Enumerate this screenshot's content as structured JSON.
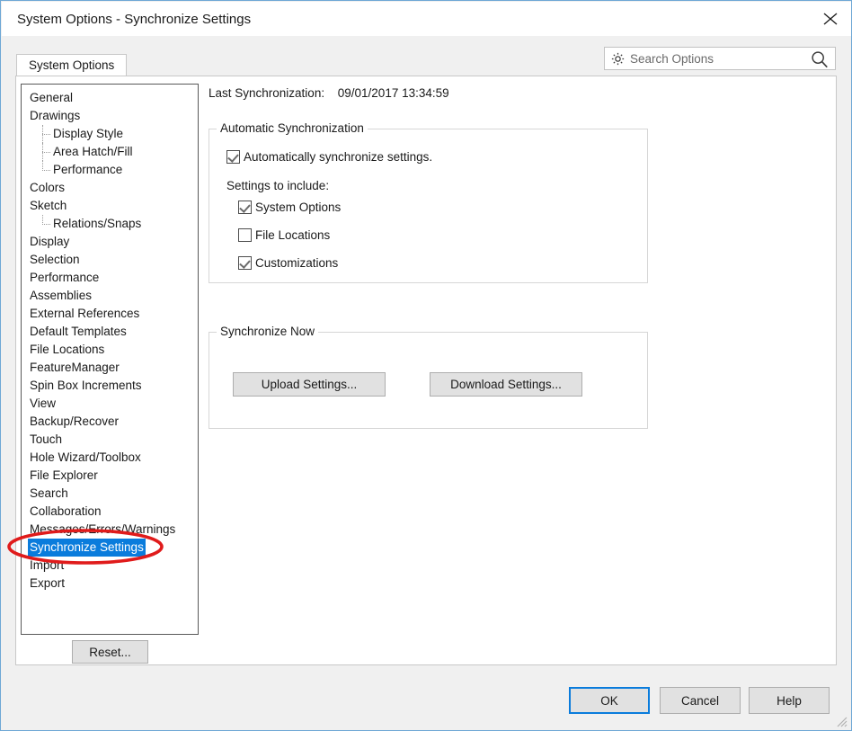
{
  "window": {
    "title": "System Options - Synchronize Settings",
    "close_icon": "close-icon",
    "resize_grip_icon": "resize-grip-icon"
  },
  "tabs": [
    {
      "label": "System Options",
      "active": true
    }
  ],
  "search": {
    "placeholder": "Search Options",
    "value": "",
    "gear_icon": "gear-icon",
    "search_icon": "magnifier-icon"
  },
  "sidebar": {
    "items": [
      {
        "label": "General",
        "level": 0,
        "selected": false
      },
      {
        "label": "Drawings",
        "level": 0,
        "selected": false
      },
      {
        "label": "Display Style",
        "level": 1,
        "selected": false
      },
      {
        "label": "Area Hatch/Fill",
        "level": 1,
        "selected": false
      },
      {
        "label": "Performance",
        "level": 1,
        "selected": false
      },
      {
        "label": "Colors",
        "level": 0,
        "selected": false
      },
      {
        "label": "Sketch",
        "level": 0,
        "selected": false
      },
      {
        "label": "Relations/Snaps",
        "level": 1,
        "selected": false
      },
      {
        "label": "Display",
        "level": 0,
        "selected": false
      },
      {
        "label": "Selection",
        "level": 0,
        "selected": false
      },
      {
        "label": "Performance",
        "level": 0,
        "selected": false
      },
      {
        "label": "Assemblies",
        "level": 0,
        "selected": false
      },
      {
        "label": "External References",
        "level": 0,
        "selected": false
      },
      {
        "label": "Default Templates",
        "level": 0,
        "selected": false
      },
      {
        "label": "File Locations",
        "level": 0,
        "selected": false
      },
      {
        "label": "FeatureManager",
        "level": 0,
        "selected": false
      },
      {
        "label": "Spin Box Increments",
        "level": 0,
        "selected": false
      },
      {
        "label": "View",
        "level": 0,
        "selected": false
      },
      {
        "label": "Backup/Recover",
        "level": 0,
        "selected": false
      },
      {
        "label": "Touch",
        "level": 0,
        "selected": false
      },
      {
        "label": "Hole Wizard/Toolbox",
        "level": 0,
        "selected": false
      },
      {
        "label": "File Explorer",
        "level": 0,
        "selected": false
      },
      {
        "label": "Search",
        "level": 0,
        "selected": false
      },
      {
        "label": "Collaboration",
        "level": 0,
        "selected": false
      },
      {
        "label": "Messages/Errors/Warnings",
        "level": 0,
        "selected": false
      },
      {
        "label": "Synchronize Settings",
        "level": 0,
        "selected": true
      },
      {
        "label": "Import",
        "level": 0,
        "selected": false
      },
      {
        "label": "Export",
        "level": 0,
        "selected": false
      }
    ],
    "reset_label": "Reset..."
  },
  "main": {
    "last_sync_label": "Last Synchronization:",
    "last_sync_value": "09/01/2017 13:34:59",
    "auto_group": {
      "title": "Automatic Synchronization",
      "auto_checkbox": {
        "label": "Automatically synchronize settings.",
        "checked": true
      },
      "settings_to_include_label": "Settings to include:",
      "include_items": [
        {
          "label": "System Options",
          "checked": true
        },
        {
          "label": "File Locations",
          "checked": false
        },
        {
          "label": "Customizations",
          "checked": true
        }
      ]
    },
    "now_group": {
      "title": "Synchronize Now",
      "upload_label": "Upload Settings...",
      "download_label": "Download Settings..."
    }
  },
  "footer": {
    "ok_label": "OK",
    "cancel_label": "Cancel",
    "help_label": "Help"
  },
  "annotation": {
    "shape": "ellipse",
    "color": "#e01b1b",
    "target": "Synchronize Settings"
  }
}
